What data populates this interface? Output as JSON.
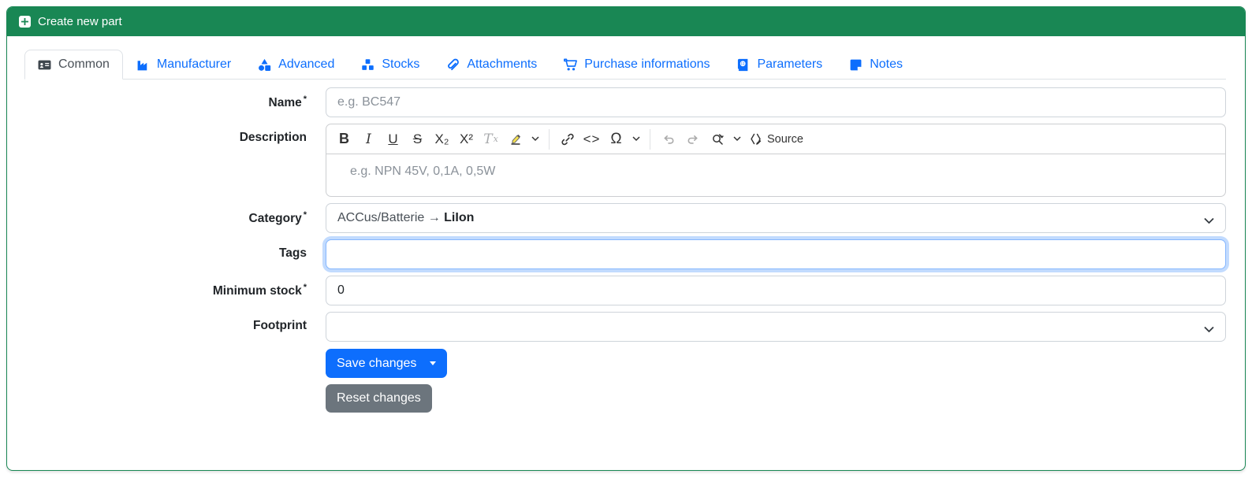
{
  "header": {
    "title": "Create new part",
    "icon": "plus-square-icon"
  },
  "colors": {
    "header_green": "#198754",
    "primary_blue": "#0d6efd",
    "secondary_gray": "#6c757d",
    "active_tab_text": "#495057"
  },
  "required_marker": "*",
  "tabs": [
    {
      "label": "Common",
      "icon": "id-card-icon",
      "active": true
    },
    {
      "label": "Manufacturer",
      "icon": "factory-icon",
      "active": false
    },
    {
      "label": "Advanced",
      "icon": "shapes-icon",
      "active": false
    },
    {
      "label": "Stocks",
      "icon": "cubes-icon",
      "active": false
    },
    {
      "label": "Attachments",
      "icon": "paperclip-icon",
      "active": false
    },
    {
      "label": "Purchase informations",
      "icon": "shopping-cart-icon",
      "active": false
    },
    {
      "label": "Parameters",
      "icon": "book-icon",
      "active": false
    },
    {
      "label": "Notes",
      "icon": "sticky-note-icon",
      "active": false
    }
  ],
  "form": {
    "name": {
      "label": "Name",
      "required": true,
      "placeholder": "e.g. BC547",
      "value": ""
    },
    "description": {
      "label": "Description",
      "placeholder": "e.g. NPN 45V, 0,1A, 0,5W",
      "toolbar": {
        "bold": "B",
        "italic": "I",
        "underline": "U",
        "strikethrough": "S",
        "subscript": "X₂",
        "superscript": "X²",
        "remove_format_t": "T",
        "remove_format_x": "x",
        "code": "<>",
        "special_char": "Ω",
        "source": "Source"
      }
    },
    "category": {
      "label": "Category",
      "required": true,
      "value_prefix": "ACCus/Batterie → ",
      "value_bold": "LiIon"
    },
    "tags": {
      "label": "Tags",
      "value": "",
      "focused": true
    },
    "minimum_stock": {
      "label": "Minimum stock",
      "required": true,
      "value": "0"
    },
    "footprint": {
      "label": "Footprint",
      "value": ""
    }
  },
  "buttons": {
    "save": "Save changes",
    "reset": "Reset changes"
  }
}
